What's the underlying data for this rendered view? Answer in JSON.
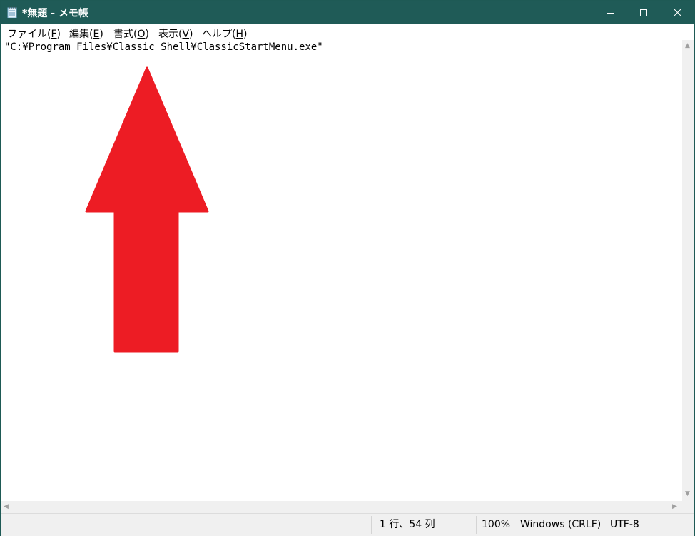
{
  "window": {
    "title": "*無題 - メモ帳",
    "controls": {
      "minimize": "minimize",
      "maximize": "maximize",
      "close": "close"
    }
  },
  "menu": [
    {
      "text": "ファイル(",
      "mnemonic": "F",
      "close": ")"
    },
    {
      "text": "編集(",
      "mnemonic": "E",
      "close": ")"
    },
    {
      "text": "書式(",
      "mnemonic": "O",
      "close": ")"
    },
    {
      "text": "表示(",
      "mnemonic": "V",
      "close": ")"
    },
    {
      "text": "ヘルプ(",
      "mnemonic": "H",
      "close": ")"
    }
  ],
  "editor": {
    "content": "\"C:¥Program Files¥Classic Shell¥ClassicStartMenu.exe\""
  },
  "annotation": {
    "icon": "up-arrow-icon",
    "color": "#ed1c24"
  },
  "status": {
    "position": "1 行、54 列",
    "zoom": "100%",
    "line_ending": "Windows (CRLF)",
    "encoding": "UTF-8"
  },
  "colors": {
    "titlebar": "#1f5b57",
    "annotation": "#ed1c24"
  }
}
